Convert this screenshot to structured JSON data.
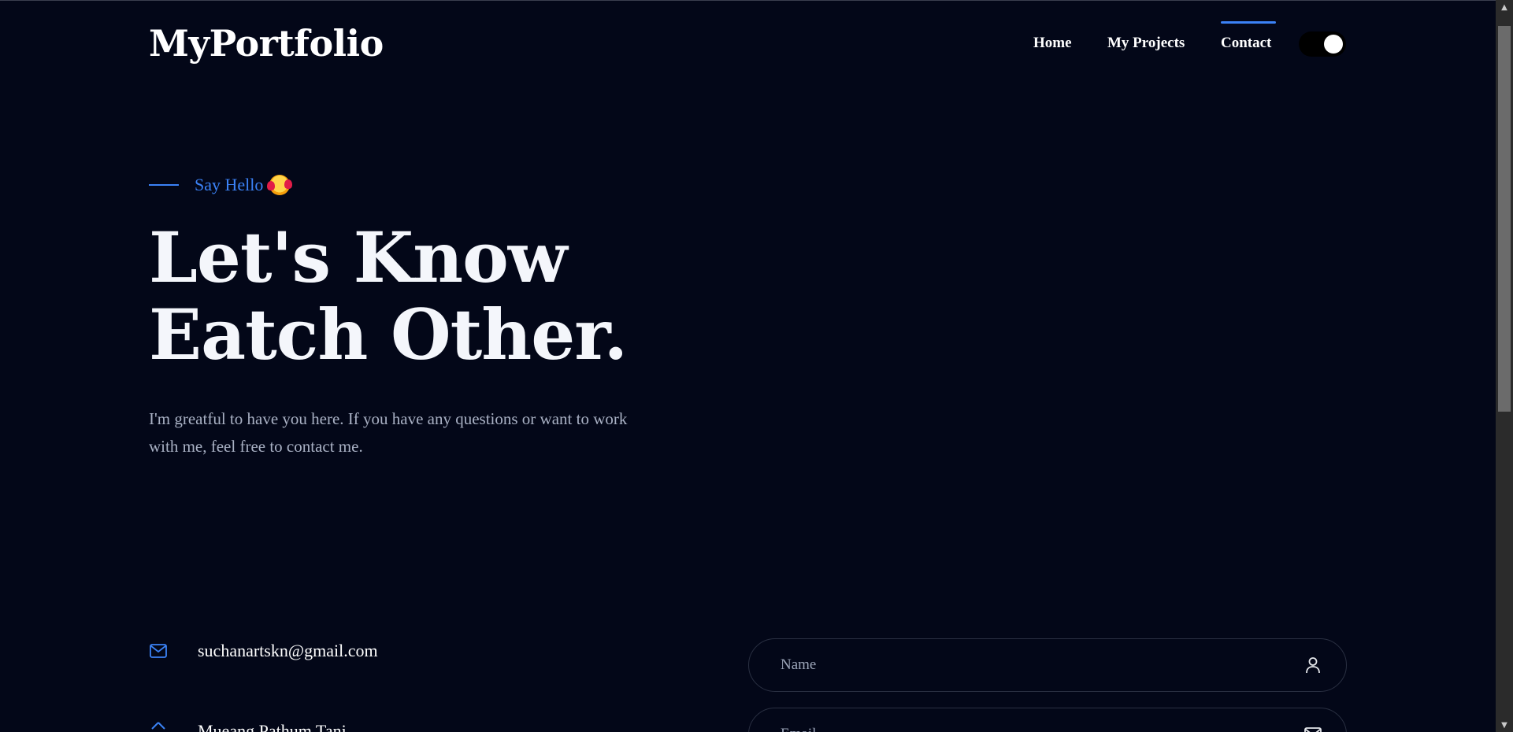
{
  "header": {
    "logo": "MyPortfolio",
    "nav": [
      {
        "label": "Home"
      },
      {
        "label": "My Projects"
      },
      {
        "label": "Contact",
        "active": true
      }
    ],
    "theme_toggle": {
      "state": "on"
    }
  },
  "hero": {
    "eyebrow": "Say Hello",
    "eyebrow_icon": "smiling-face-with-hearts-emoji",
    "headline_line1": "Let's Know",
    "headline_line2": "Eatch Other.",
    "lead": "I'm greatful to have you here. If you have any questions or want to work with me, feel free to contact me."
  },
  "contact": {
    "email": "suchanartskn@gmail.com",
    "address": "Mueang Pathum Tani"
  },
  "form": {
    "name_placeholder": "Name",
    "email_placeholder": "Email"
  },
  "colors": {
    "background": "#030718",
    "accent": "#3b82f6",
    "text_muted": "#a9b1c4"
  }
}
